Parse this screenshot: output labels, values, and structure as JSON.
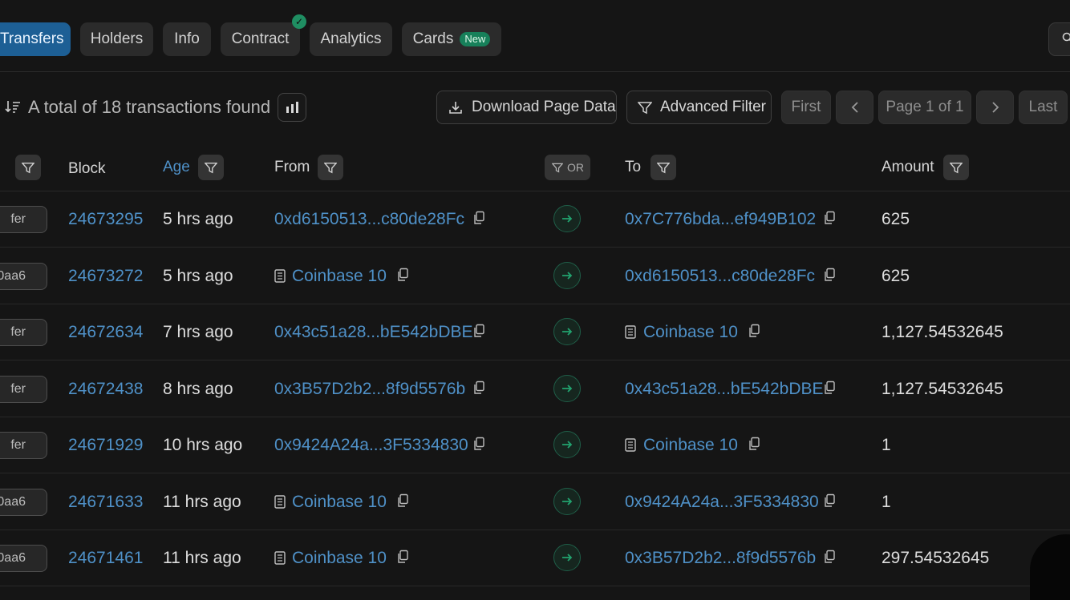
{
  "tabs": [
    {
      "label": "Transfers",
      "active": true
    },
    {
      "label": "Holders"
    },
    {
      "label": "Info"
    },
    {
      "label": "Contract",
      "verified": true
    },
    {
      "label": "Analytics"
    },
    {
      "label": "Cards",
      "badge": "New"
    }
  ],
  "toolbar": {
    "summary": "A total of 18 transactions found",
    "download_label": "Download Page Data",
    "advanced_filter_label": "Advanced Filter",
    "pagination": {
      "first": "First",
      "page_text": "Page 1 of 1",
      "last": "Last"
    }
  },
  "table": {
    "headers": {
      "block": "Block",
      "age": "Age",
      "from": "From",
      "or": "OR",
      "to": "To",
      "amount": "Amount"
    },
    "rows": [
      {
        "method": "fer",
        "block": "24673295",
        "age": "5 hrs ago",
        "from": "0xd6150513...c80de28Fc",
        "from_contract": false,
        "to": "0x7C776bda...ef949B102",
        "to_contract": false,
        "amount": "625"
      },
      {
        "method": "0aa6",
        "block": "24673272",
        "age": "5 hrs ago",
        "from": "Coinbase 10",
        "from_contract": true,
        "to": "0xd6150513...c80de28Fc",
        "to_contract": false,
        "amount": "625"
      },
      {
        "method": "fer",
        "block": "24672634",
        "age": "7 hrs ago",
        "from": "0x43c51a28...bE542bDBE",
        "from_contract": false,
        "to": "Coinbase 10",
        "to_contract": true,
        "amount": "1,127.54532645"
      },
      {
        "method": "fer",
        "block": "24672438",
        "age": "8 hrs ago",
        "from": "0x3B57D2b2...8f9d5576b",
        "from_contract": false,
        "to": "0x43c51a28...bE542bDBE",
        "to_contract": false,
        "amount": "1,127.54532645"
      },
      {
        "method": "fer",
        "block": "24671929",
        "age": "10 hrs ago",
        "from": "0x9424A24a...3F5334830",
        "from_contract": false,
        "to": "Coinbase 10",
        "to_contract": true,
        "amount": "1"
      },
      {
        "method": "0aa6",
        "block": "24671633",
        "age": "11 hrs ago",
        "from": "Coinbase 10",
        "from_contract": true,
        "to": "0x9424A24a...3F5334830",
        "to_contract": false,
        "amount": "1"
      },
      {
        "method": "0aa6",
        "block": "24671461",
        "age": "11 hrs ago",
        "from": "Coinbase 10",
        "from_contract": true,
        "to": "0x3B57D2b2...8f9d5576b",
        "to_contract": false,
        "amount": "297.54532645"
      }
    ]
  },
  "colors": {
    "background": "#151515",
    "link": "#4f91c8",
    "active_tab": "#1d5f95",
    "success": "#1f8e62"
  },
  "icons": [
    "search-icon",
    "sort-icon",
    "chart-bars-icon",
    "download-icon",
    "filter-icon",
    "chevron-left-icon",
    "chevron-right-icon",
    "copy-icon",
    "document-icon",
    "arrow-right-icon",
    "check-icon"
  ]
}
